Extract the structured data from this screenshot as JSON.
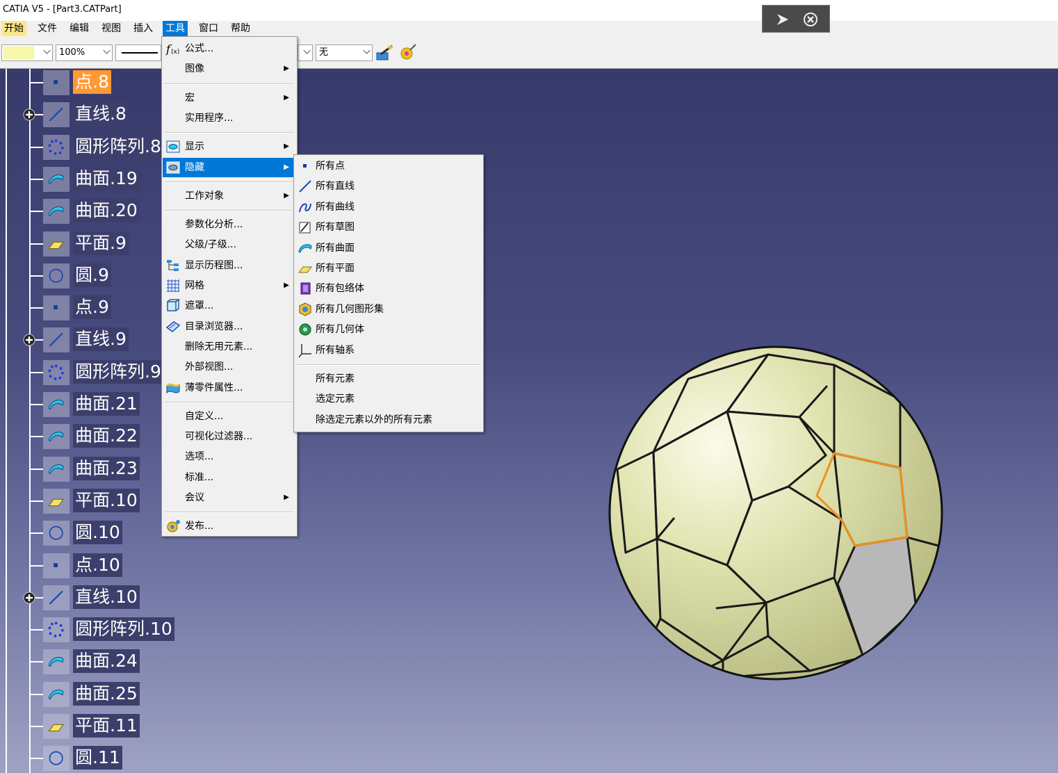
{
  "window": {
    "title": "CATIA V5 - [Part3.CATPart]"
  },
  "menubar": {
    "items": [
      "开始",
      "文件",
      "编辑",
      "视图",
      "插入",
      "工具",
      "窗口",
      "帮助"
    ],
    "active": "工具"
  },
  "toolbar": {
    "color_combo": "",
    "zoom_combo": "100%",
    "layer_combo": "无"
  },
  "tree": {
    "nodes": [
      {
        "label": "点.8",
        "icon": "point-icon",
        "selected": true
      },
      {
        "label": "直线.8",
        "icon": "line-icon",
        "expandable": true
      },
      {
        "label": "圆形阵列.8",
        "icon": "circular-pattern-icon"
      },
      {
        "label": "曲面.19",
        "icon": "surface-icon"
      },
      {
        "label": "曲面.20",
        "icon": "surface-icon"
      },
      {
        "label": "平面.9",
        "icon": "plane-icon"
      },
      {
        "label": "圆.9",
        "icon": "circle-icon"
      },
      {
        "label": "点.9",
        "icon": "point-icon"
      },
      {
        "label": "直线.9",
        "icon": "line-icon",
        "expandable": true
      },
      {
        "label": "圆形阵列.9",
        "icon": "circular-pattern-icon"
      },
      {
        "label": "曲面.21",
        "icon": "surface-icon"
      },
      {
        "label": "曲面.22",
        "icon": "surface-icon"
      },
      {
        "label": "曲面.23",
        "icon": "surface-icon"
      },
      {
        "label": "平面.10",
        "icon": "plane-icon"
      },
      {
        "label": "圆.10",
        "icon": "circle-icon"
      },
      {
        "label": "点.10",
        "icon": "point-icon"
      },
      {
        "label": "直线.10",
        "icon": "line-icon",
        "expandable": true
      },
      {
        "label": "圆形阵列.10",
        "icon": "circular-pattern-icon"
      },
      {
        "label": "曲面.24",
        "icon": "surface-icon"
      },
      {
        "label": "曲面.25",
        "icon": "surface-icon"
      },
      {
        "label": "平面.11",
        "icon": "plane-icon"
      },
      {
        "label": "圆.11",
        "icon": "circle-icon"
      }
    ]
  },
  "tools_menu": {
    "items": [
      {
        "label": "公式...",
        "icon": "formula-icon"
      },
      {
        "label": "图像",
        "submenu": true
      },
      {
        "sep": true
      },
      {
        "label": "宏",
        "submenu": true
      },
      {
        "label": "实用程序..."
      },
      {
        "sep": true
      },
      {
        "label": "显示",
        "icon": "show-icon",
        "submenu": true
      },
      {
        "label": "隐藏",
        "icon": "hide-icon",
        "submenu": true,
        "highlighted": true
      },
      {
        "sep": true
      },
      {
        "label": "工作对象",
        "submenu": true
      },
      {
        "sep": true
      },
      {
        "label": "参数化分析..."
      },
      {
        "label": "父级/子级..."
      },
      {
        "label": "显示历程图...",
        "icon": "history-graph-icon"
      },
      {
        "label": "网格",
        "icon": "grid-icon",
        "submenu": true
      },
      {
        "label": "遮罩...",
        "icon": "mask-icon"
      },
      {
        "label": "目录浏览器...",
        "icon": "catalog-browser-icon"
      },
      {
        "label": "删除无用元素..."
      },
      {
        "label": "外部视图..."
      },
      {
        "label": "薄零件属性...",
        "icon": "thin-part-icon"
      },
      {
        "sep": true
      },
      {
        "label": "自定义..."
      },
      {
        "label": "可视化过滤器..."
      },
      {
        "label": "选项..."
      },
      {
        "label": "标准..."
      },
      {
        "label": "会议",
        "submenu": true
      },
      {
        "sep": true
      },
      {
        "label": "发布...",
        "icon": "publish-icon"
      }
    ]
  },
  "hide_submenu": {
    "items": [
      {
        "label": "所有点",
        "icon": "point-icon"
      },
      {
        "label": "所有直线",
        "icon": "line-icon"
      },
      {
        "label": "所有曲线",
        "icon": "curve-icon"
      },
      {
        "label": "所有草图",
        "icon": "sketch-icon"
      },
      {
        "label": "所有曲面",
        "icon": "surface-icon"
      },
      {
        "label": "所有平面",
        "icon": "plane-icon"
      },
      {
        "label": "所有包络体",
        "icon": "volume-icon"
      },
      {
        "label": "所有几何图形集",
        "icon": "geometrical-set-icon"
      },
      {
        "label": "所有几何体",
        "icon": "body-icon"
      },
      {
        "label": "所有轴系",
        "icon": "axis-system-icon"
      },
      {
        "sep": true
      },
      {
        "label": "所有元素"
      },
      {
        "label": "选定元素"
      },
      {
        "label": "除选定元素以外的所有元素"
      }
    ]
  },
  "colors": {
    "menu_highlight": "#0078d7",
    "selected_node": "#ff9933",
    "ball_fill": "#d8dca6",
    "ball_selected_edge": "#f09020",
    "ball_grey_face": "#b8b8b8"
  }
}
